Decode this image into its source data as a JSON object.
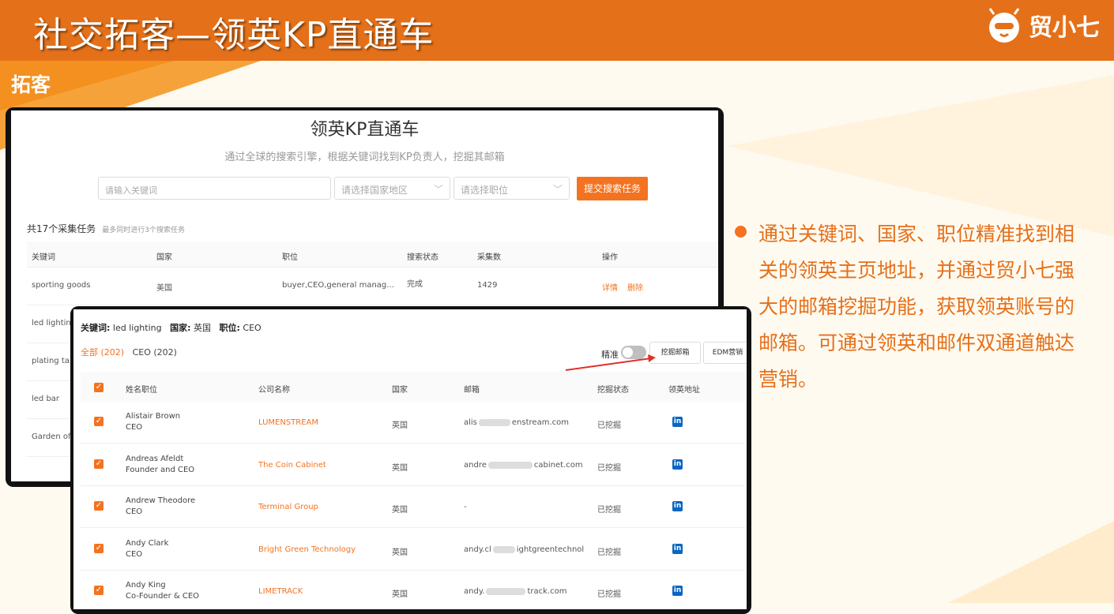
{
  "header": {
    "title": "社交拓客—领英KP直通车",
    "brand": "贸小七"
  },
  "section_title": "拓客",
  "colors": {
    "accent": "#f37321",
    "header_bg": "#e5701a",
    "linkedin": "#0a66c2"
  },
  "search_page": {
    "title": "领英KP直通车",
    "subtitle": "通过全球的搜索引擎，根据关键词找到KP负责人，挖掘其邮箱",
    "keyword_placeholder": "请输入关键词",
    "country_placeholder": "请选择国家地区",
    "position_placeholder": "请选择职位",
    "submit_label": "提交搜索任务",
    "task_count": "共17个采集任务",
    "task_note": "最多同时进行3个搜索任务",
    "columns": [
      "关键词",
      "国家",
      "职位",
      "搜索状态",
      "采集数",
      "操作"
    ],
    "rows": [
      {
        "keyword": "sporting goods",
        "country": "美国",
        "position": "buyer,CEO,general manag...",
        "status": "完成",
        "count": "1429",
        "detail": "详情",
        "delete": "删除"
      },
      {
        "keyword": "led lightin"
      },
      {
        "keyword": "plating ta"
      },
      {
        "keyword": "led bar"
      },
      {
        "keyword": "Garden of"
      }
    ]
  },
  "result_page": {
    "criteria": {
      "keyword_label": "关键词:",
      "keyword": "led lighting",
      "country_label": "国家:",
      "country": "英国",
      "position_label": "职位:",
      "position": "CEO"
    },
    "tab_all": "全部 (202)",
    "tab_ceo": "CEO (202)",
    "toggle_label": "精准",
    "mine_button": "挖掘邮箱",
    "edm_button": "EDM营销",
    "columns": [
      "姓名职位",
      "公司名称",
      "国家",
      "邮箱",
      "挖掘状态",
      "领英地址"
    ],
    "rows": [
      {
        "name": "Alistair Brown",
        "title": "CEO",
        "company": "LUMENSTREAM",
        "country": "英国",
        "email_pre": "alis",
        "email_post": "enstream.com",
        "status": "已挖掘"
      },
      {
        "name": "Andreas Afeldt",
        "title": "Founder and CEO",
        "company": "The Coin Cabinet",
        "country": "英国",
        "email_pre": "andre",
        "email_post": "cabinet.com",
        "status": "已挖掘"
      },
      {
        "name": "Andrew Theodore",
        "title": "CEO",
        "company": "Terminal Group",
        "country": "英国",
        "email_pre": "-",
        "email_post": "",
        "status": "已挖掘"
      },
      {
        "name": "Andy Clark",
        "title": "CEO",
        "company": "Bright Green Technology",
        "country": "英国",
        "email_pre": "andy.cl",
        "email_post": "ightgreentechnol",
        "status": "已挖掘"
      },
      {
        "name": "Andy King",
        "title": "Co-Founder & CEO",
        "company": "LIMETRACK",
        "country": "英国",
        "email_pre": "andy.",
        "email_post": "track.com",
        "status": "已挖掘"
      }
    ]
  },
  "description": "通过关键词、国家、职位精准找到相关的领英主页地址，并通过贸小七强大的邮箱挖掘功能，获取领英账号的邮箱。可通过领英和邮件双通道触达营销。"
}
